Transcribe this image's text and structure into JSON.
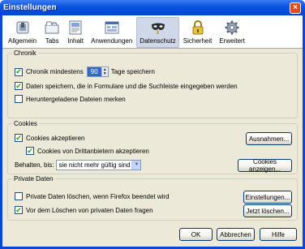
{
  "window": {
    "title": "Einstellungen",
    "close_glyph": "×"
  },
  "toolbar": {
    "items": [
      {
        "label": "Allgemein",
        "icon": "switch-icon"
      },
      {
        "label": "Tabs",
        "icon": "tabs-icon"
      },
      {
        "label": "Inhalt",
        "icon": "content-icon"
      },
      {
        "label": "Anwendungen",
        "icon": "applications-icon"
      },
      {
        "label": "Datenschutz",
        "icon": "privacy-mask-icon"
      },
      {
        "label": "Sicherheit",
        "icon": "lock-icon"
      },
      {
        "label": "Erweitert",
        "icon": "gear-icon"
      }
    ],
    "selected": "Datenschutz"
  },
  "chronik": {
    "legend": "Chronik",
    "keep_history_before": "Chronik mindestens",
    "days_value": "90",
    "keep_history_after": "Tage speichern",
    "keep_history_checked": true,
    "form_data_label": "Daten speichern, die in Formulare und die Suchleiste eingegeben werden",
    "form_data_checked": true,
    "downloads_label": "Heruntergeladene Dateien merken",
    "downloads_checked": false
  },
  "cookies": {
    "legend": "Cookies",
    "accept_label": "Cookies akzeptieren",
    "accept_checked": true,
    "third_party_label": "Cookies von Drittanbietern akzeptieren",
    "third_party_checked": true,
    "keep_label": "Behalten, bis:",
    "keep_value": "sie nicht mehr gültig sind",
    "exceptions_button": "Ausnahmen...",
    "show_cookies_button": "Cookies anzeigen..."
  },
  "private_data": {
    "legend": "Private Daten",
    "clear_on_close_label": "Private Daten löschen, wenn Firefox beendet wird",
    "clear_on_close_checked": false,
    "ask_before_label": "Vor dem Löschen von privaten Daten fragen",
    "ask_before_checked": true,
    "settings_button": "Einstellungen...",
    "clear_now_button": "Jetzt löschen..."
  },
  "buttons": {
    "ok": "OK",
    "cancel": "Abbrechen",
    "help": "Hilfe"
  },
  "check_glyph": "✔"
}
